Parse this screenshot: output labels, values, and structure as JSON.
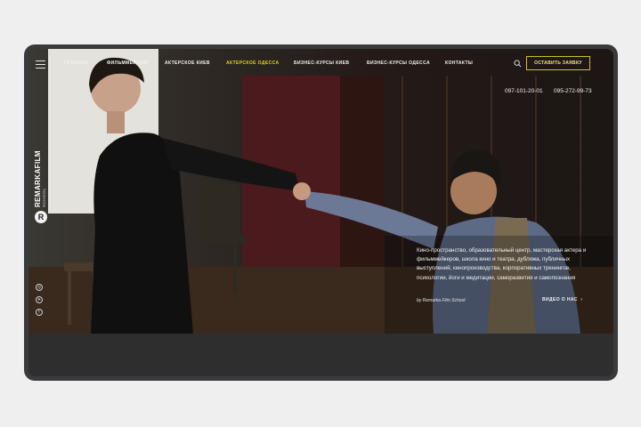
{
  "header": {
    "nav": [
      {
        "label": "Главная",
        "active": false
      },
      {
        "label": "Фильммейкинг",
        "active": false
      },
      {
        "label": "Актерское Киев",
        "active": false
      },
      {
        "label": "Актерское Одесса",
        "active": true
      },
      {
        "label": "Бизнес-курсы Киев",
        "active": false
      },
      {
        "label": "Бизнес-курсы Одесса",
        "active": false
      },
      {
        "label": "Контакты",
        "active": false
      }
    ],
    "cta_label": "Оставить заявку",
    "phones": [
      "097-101-20-01",
      "095-272-99-73"
    ]
  },
  "brand": {
    "name": "REMARKAFILM",
    "sub": "SCHOOL",
    "logo_letter": "R"
  },
  "hero": {
    "description": "Кино-пространство, образовательный центр, мастерская актера и фильммейкеров, школа кино и театра, дубляжа, публичных выступлений, кинопроизводства, корпоративных тренингов, психологии, йоги и медитации, саморазвития и самопознания",
    "credit": "by Remarka Film School",
    "video_link": "Видео о нас"
  },
  "socials": [
    "instagram-icon",
    "telegram-icon",
    "facebook-icon"
  ],
  "colors": {
    "accent": "#d9d024",
    "frame": "#3a3a3c",
    "page_bg": "#efefef"
  }
}
